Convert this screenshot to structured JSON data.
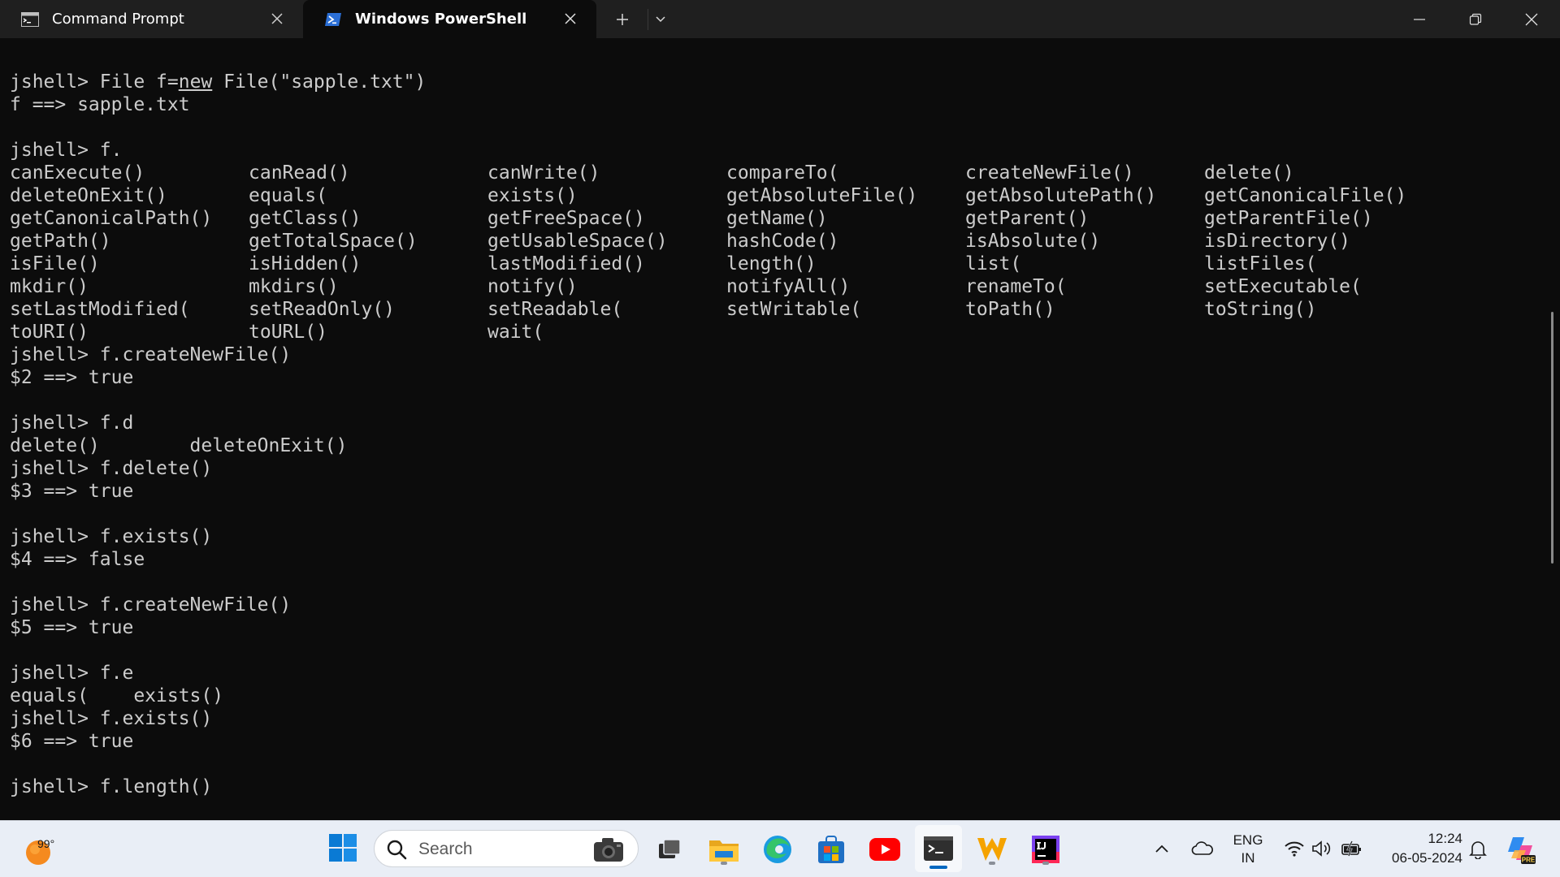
{
  "tabs": [
    {
      "label": "Command Prompt",
      "active": false,
      "icon": "cmd-icon"
    },
    {
      "label": "Windows PowerShell",
      "active": true,
      "icon": "powershell-icon"
    }
  ],
  "tabbar": {
    "new_tab_symbol": "+",
    "dropdown_icon": "chevron-down-icon"
  },
  "window_controls": [
    "minimize-icon",
    "maximize-icon",
    "close-icon"
  ],
  "terminal": {
    "lines": [
      {
        "text": "jshell> File f=new File(\"sapple.txt\")"
      },
      {
        "text": "f ==> sapple.txt"
      },
      {
        "text": ""
      },
      {
        "text": "jshell> f."
      },
      {
        "cells": [
          "canExecute()",
          "canRead()",
          "canWrite()",
          "compareTo(",
          "createNewFile()",
          "delete()"
        ]
      },
      {
        "cells": [
          "deleteOnExit()",
          "equals(",
          "exists()",
          "getAbsoluteFile()",
          "getAbsolutePath()",
          "getCanonicalFile()"
        ]
      },
      {
        "cells": [
          "getCanonicalPath()",
          "getClass()",
          "getFreeSpace()",
          "getName()",
          "getParent()",
          "getParentFile()"
        ]
      },
      {
        "cells": [
          "getPath()",
          "getTotalSpace()",
          "getUsableSpace()",
          "hashCode()",
          "isAbsolute()",
          "isDirectory()"
        ]
      },
      {
        "cells": [
          "isFile()",
          "isHidden()",
          "lastModified()",
          "length()",
          "list(",
          "listFiles("
        ]
      },
      {
        "cells": [
          "mkdir()",
          "mkdirs()",
          "notify()",
          "notifyAll()",
          "renameTo(",
          "setExecutable("
        ]
      },
      {
        "cells": [
          "setLastModified(",
          "setReadOnly()",
          "setReadable(",
          "setWritable(",
          "toPath()",
          "toString()"
        ]
      },
      {
        "cells": [
          "toURI()",
          "toURL()",
          "wait("
        ]
      },
      {
        "text": "jshell> f.createNewFile()"
      },
      {
        "text": "$2 ==> true"
      },
      {
        "text": ""
      },
      {
        "text": "jshell> f.d"
      },
      {
        "text": "delete()        deleteOnExit()"
      },
      {
        "text": "jshell> f.delete()"
      },
      {
        "text": "$3 ==> true"
      },
      {
        "text": ""
      },
      {
        "text": "jshell> f.exists()"
      },
      {
        "text": "$4 ==> false"
      },
      {
        "text": ""
      },
      {
        "text": "jshell> f.createNewFile()"
      },
      {
        "text": "$5 ==> true"
      },
      {
        "text": ""
      },
      {
        "text": "jshell> f.e"
      },
      {
        "text": "equals(    exists()"
      },
      {
        "text": "jshell> f.exists()"
      },
      {
        "text": "$6 ==> true"
      },
      {
        "text": ""
      },
      {
        "text": "jshell> f.length()"
      }
    ]
  },
  "taskbar": {
    "weather_temp": "99°",
    "search_placeholder": "Search",
    "pinned_apps": [
      "task-view-icon",
      "file-explorer-icon",
      "edge-icon",
      "ms-store-icon",
      "youtube-icon",
      "terminal-icon",
      "wps-office-icon",
      "intellij-icon"
    ],
    "tray": {
      "lang_line1": "ENG",
      "lang_line2": "IN",
      "time": "12:24",
      "date": "06-05-2024"
    }
  },
  "colors": {
    "terminal_bg": "#0c0c0c",
    "terminal_fg": "#cccccc",
    "tabbar_bg": "#1f1f1f",
    "taskbar_bg": "#e9eef6",
    "accent": "#0067c0"
  }
}
